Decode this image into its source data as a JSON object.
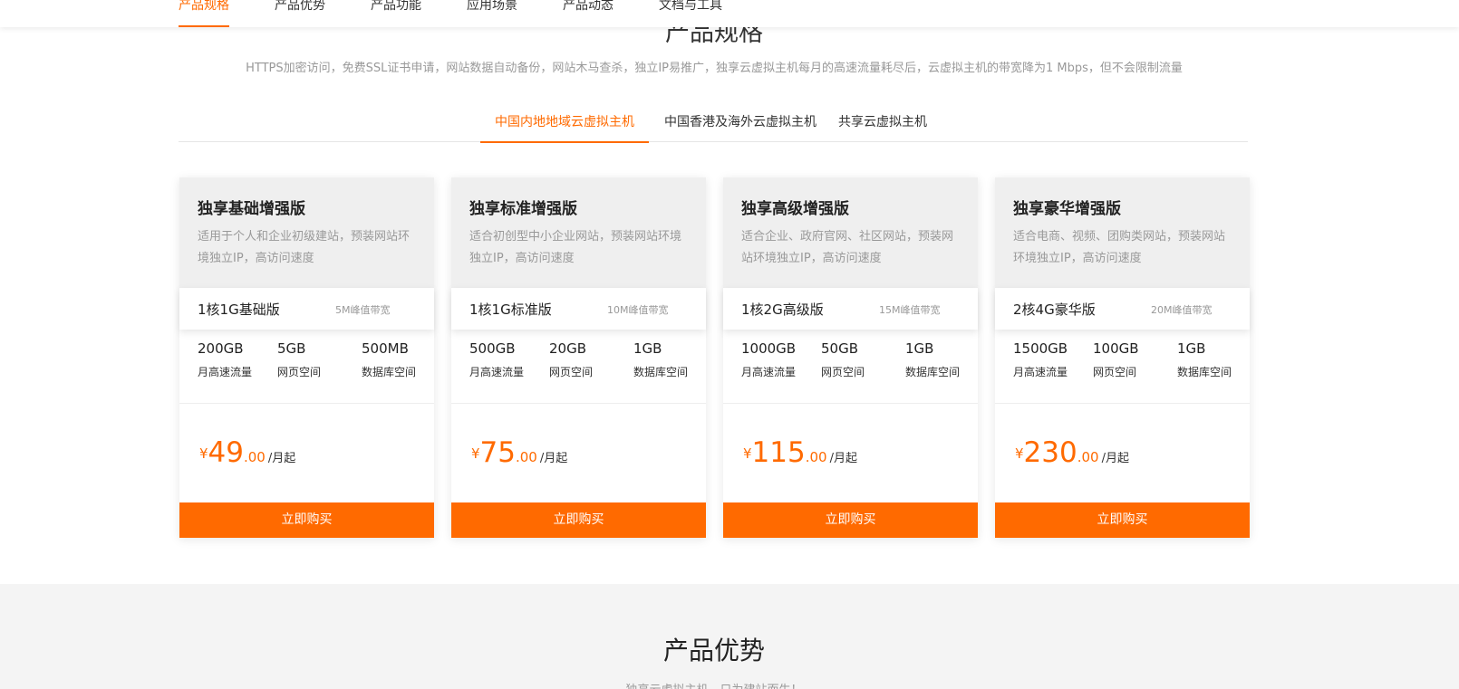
{
  "nav": {
    "items": [
      "产品规格",
      "产品优势",
      "产品功能",
      "应用场景",
      "产品动态",
      "文档与工具"
    ],
    "active_index": 0
  },
  "spec_section": {
    "title": "产品规格",
    "description": "HTTPS加密访问，免费SSL证书申请，网站数据自动备份，网站木马查杀，独立IP易推广，独享云虚拟主机每月的高速流量耗尽后，云虚拟主机的带宽降为1 Mbps，但不会限制流量"
  },
  "tabs": {
    "items": [
      "中国内地地域云虚拟主机",
      "中国香港及海外云虚拟主机",
      "共享云虚拟主机"
    ],
    "active_index": 0
  },
  "stat_labels": [
    "月高速流量",
    "网页空间",
    "数据库空间"
  ],
  "price_unit": "/月起",
  "currency": "¥",
  "buy_label": "立即购买",
  "cards": [
    {
      "name": "独享基础增强版",
      "desc": "适用于个人和企业初级建站，预装网站环境独立IP，高访问速度",
      "spec": "1核1G基础版",
      "bandwidth": "5M峰值带宽",
      "traffic": "200GB",
      "web_space": "5GB",
      "db_space": "500MB",
      "price_int": "49",
      "price_dec": ".00"
    },
    {
      "name": "独享标准增强版",
      "desc": "适合初创型中小企业网站，预装网站环境独立IP，高访问速度",
      "spec": "1核1G标准版",
      "bandwidth": "10M峰值带宽",
      "traffic": "500GB",
      "web_space": "20GB",
      "db_space": "1GB",
      "price_int": "75",
      "price_dec": ".00"
    },
    {
      "name": "独享高级增强版",
      "desc": "适合企业、政府官网、社区网站，预装网站环境独立IP，高访问速度",
      "spec": "1核2G高级版",
      "bandwidth": "15M峰值带宽",
      "traffic": "1000GB",
      "web_space": "50GB",
      "db_space": "1GB",
      "price_int": "115",
      "price_dec": ".00"
    },
    {
      "name": "独享豪华增强版",
      "desc": "适合电商、视频、团购类网站，预装网站环境独立IP，高访问速度",
      "spec": "2核4G豪华版",
      "bandwidth": "20M峰值带宽",
      "traffic": "1500GB",
      "web_space": "100GB",
      "db_space": "1GB",
      "price_int": "230",
      "price_dec": ".00"
    }
  ],
  "advantage": {
    "title": "产品优势",
    "subtitle": "独享云虚拟主机，只为建站而生！"
  },
  "colors": {
    "accent": "#ff6a00",
    "card_head_bg": "#efefef",
    "section_bg": "#f4f4f4"
  }
}
